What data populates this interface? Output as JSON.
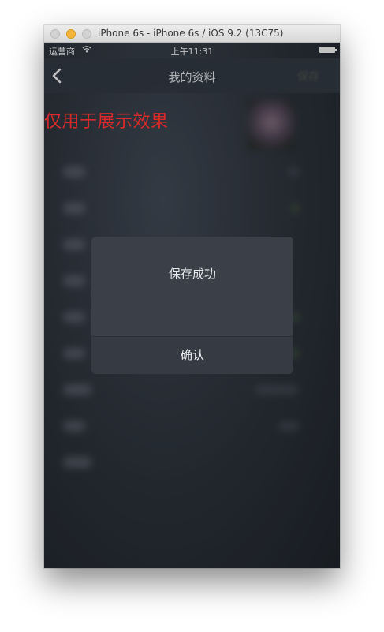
{
  "window": {
    "title": "iPhone 6s - iPhone 6s / iOS 9.2 (13C75)"
  },
  "status_bar": {
    "carrier": "运营商",
    "time": "上午11:31"
  },
  "nav_bar": {
    "title": "我的资料",
    "save_label": "保存"
  },
  "watermark": "仅用于展示效果",
  "alert": {
    "message": "保存成功",
    "confirm_label": "确认"
  },
  "icons": {
    "back": "chevron-left-icon",
    "wifi": "wifi-icon",
    "battery": "battery-icon"
  },
  "colors": {
    "watermark": "#d82a2a",
    "traffic_minimize": "#f5b43b",
    "alert_background": "#3b3f48"
  }
}
